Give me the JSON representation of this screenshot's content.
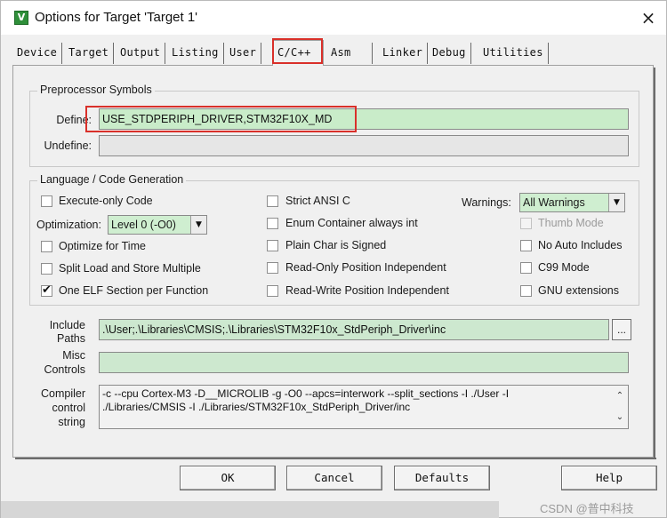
{
  "window": {
    "title": "Options for Target 'Target 1'",
    "app_icon_glyph": "V",
    "close_glyph": "×"
  },
  "tabs": [
    {
      "label": "Device"
    },
    {
      "label": "Target"
    },
    {
      "label": "Output"
    },
    {
      "label": "Listing"
    },
    {
      "label": "User"
    },
    {
      "label": "C/C++"
    },
    {
      "label": "Asm"
    },
    {
      "label": "Linker"
    },
    {
      "label": "Debug"
    },
    {
      "label": "Utilities"
    }
  ],
  "active_tab": "C/C++",
  "preprocessor": {
    "legend": "Preprocessor Symbols",
    "define_label": "Define:",
    "define_value": "USE_STDPERIPH_DRIVER,STM32F10X_MD",
    "undefine_label": "Undefine:",
    "undefine_value": ""
  },
  "language": {
    "legend": "Language / Code Generation",
    "execute_only": {
      "label": "Execute-only Code",
      "checked": false
    },
    "optimization_label": "Optimization:",
    "optimization_value": "Level 0 (-O0)",
    "optimize_time": {
      "label": "Optimize for Time",
      "checked": false
    },
    "split_load": {
      "label": "Split Load and Store Multiple",
      "checked": false
    },
    "one_elf": {
      "label": "One ELF Section per Function",
      "checked": true
    },
    "strict_ansi": {
      "label": "Strict ANSI C",
      "checked": false
    },
    "enum_container": {
      "label": "Enum Container always int",
      "checked": false
    },
    "plain_char": {
      "label": "Plain Char is Signed",
      "checked": false
    },
    "ro_pi": {
      "label": "Read-Only Position Independent",
      "checked": false
    },
    "rw_pi": {
      "label": "Read-Write Position Independent",
      "checked": false
    },
    "warnings_label": "Warnings:",
    "warnings_value": "All Warnings",
    "thumb_mode": {
      "label": "Thumb Mode",
      "checked": false,
      "enabled": false
    },
    "no_auto_includes": {
      "label": "No Auto Includes",
      "checked": false
    },
    "c99_mode": {
      "label": "C99 Mode",
      "checked": false
    },
    "gnu_ext": {
      "label": "GNU extensions",
      "checked": false
    }
  },
  "paths": {
    "include_label_1": "Include",
    "include_label_2": "Paths",
    "include_value": ".\\User;.\\Libraries\\CMSIS;.\\Libraries\\STM32F10x_StdPeriph_Driver\\inc",
    "browse_label": "...",
    "misc_label_1": "Misc",
    "misc_label_2": "Controls",
    "misc_value": "",
    "compiler_label_1": "Compiler",
    "compiler_label_2": "control",
    "compiler_label_3": "string",
    "compiler_line_1": "-c --cpu Cortex-M3 -D__MICROLIB -g -O0 --apcs=interwork --split_sections -I ./User -I",
    "compiler_line_2": "./Libraries/CMSIS -I ./Libraries/STM32F10x_StdPeriph_Driver/inc"
  },
  "buttons": {
    "ok": "OK",
    "cancel": "Cancel",
    "defaults": "Defaults",
    "help": "Help"
  },
  "watermark": "CSDN @普中科技",
  "colors": {
    "highlight_box": "#d9302a",
    "field_green": "#c9ecc9"
  }
}
